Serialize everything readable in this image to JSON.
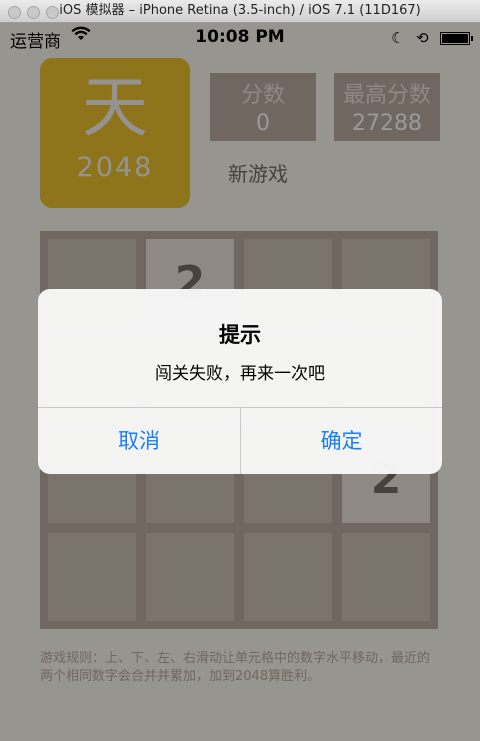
{
  "window": {
    "title": "iOS 模拟器 – iPhone Retina (3.5-inch) / iOS 7.1 (11D167)"
  },
  "status_bar": {
    "carrier": "运营商",
    "time": "10:08 PM"
  },
  "logo": {
    "char": "天",
    "number": "2048"
  },
  "score": {
    "label": "分数",
    "value": "0"
  },
  "best": {
    "label": "最高分数",
    "value": "27288"
  },
  "new_game_label": "新游戏",
  "board": {
    "size": 4,
    "cells": [
      [
        "",
        "2",
        "",
        ""
      ],
      [
        "",
        "",
        "",
        ""
      ],
      [
        "",
        "",
        "",
        "2"
      ],
      [
        "",
        "",
        "",
        ""
      ]
    ]
  },
  "rules": "游戏规则：上、下、左、右滑动让单元格中的数字水平移动，最近的两个相同数字会合并并累加，加到2048算胜利。",
  "alert": {
    "title": "提示",
    "message": "闯关失败，再来一次吧",
    "cancel_label": "取消",
    "ok_label": "确定"
  }
}
